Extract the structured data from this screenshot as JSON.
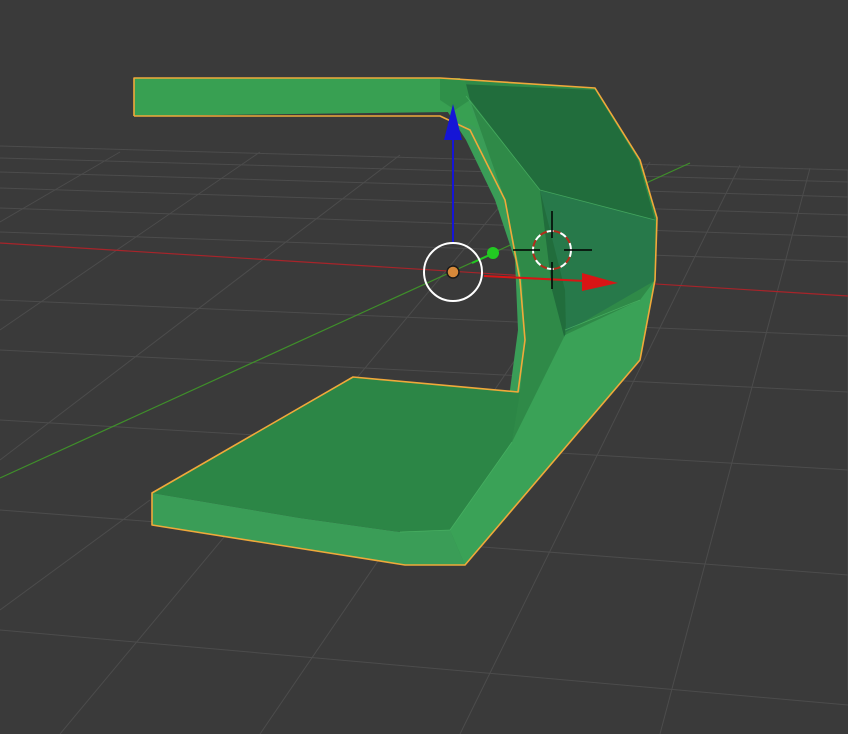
{
  "viewport": {
    "background": "#3a3a3a",
    "grid_color": "#4c4c4c",
    "x_axis_color": "#a8242a",
    "y_axis_color": "#3f8f2a"
  },
  "object": {
    "selected": true,
    "face_color": "#389d52",
    "face_dark_color": "#216d3c",
    "outline_color": "#f0a93a"
  },
  "gizmo": {
    "z_arrow_color": "#1515d6",
    "x_arrow_color": "#d81515",
    "y_handle_color": "#22c922",
    "origin_color": "#d7893a"
  },
  "cursor_3d": {
    "ring_colors": [
      "#b22d1a",
      "#ffffff"
    ]
  }
}
